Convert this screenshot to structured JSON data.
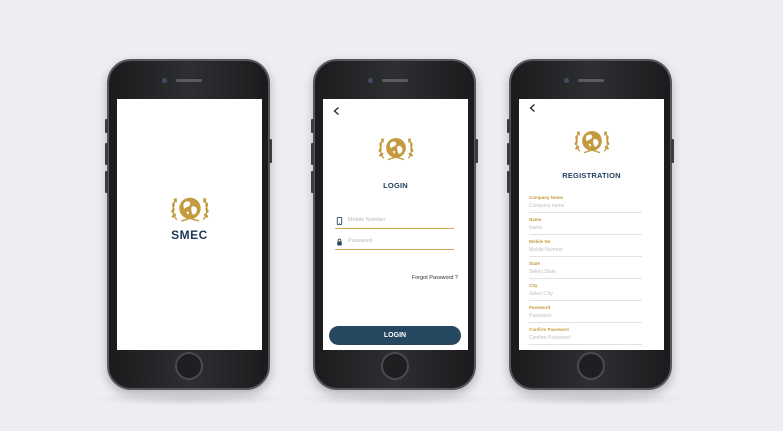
{
  "splash": {
    "brand": "SMEC"
  },
  "login": {
    "title": "LOGIN",
    "mobile_placeholder": "Mobile Number",
    "password_placeholder": "Password",
    "forgot": "Forgot Password ?",
    "button": "LOGIN"
  },
  "registration": {
    "title": "REGISTRATION",
    "fields": [
      {
        "label": "Company Name",
        "placeholder": "Company name"
      },
      {
        "label": "Name",
        "placeholder": "Name"
      },
      {
        "label": "Mobile No",
        "placeholder": "Mobile Number"
      },
      {
        "label": "State",
        "placeholder": "Select State"
      },
      {
        "label": "City",
        "placeholder": "Select City"
      },
      {
        "label": "Password",
        "placeholder": "Password"
      },
      {
        "label": "Confirm Password",
        "placeholder": "Confirm Password"
      }
    ]
  },
  "colors": {
    "gold": "#c39a3e",
    "navy": "#254860",
    "background": "#eceef2"
  },
  "icons": [
    "back-arrow-icon",
    "mobile-icon",
    "lock-icon",
    "globe-laurel-logo-icon"
  ]
}
